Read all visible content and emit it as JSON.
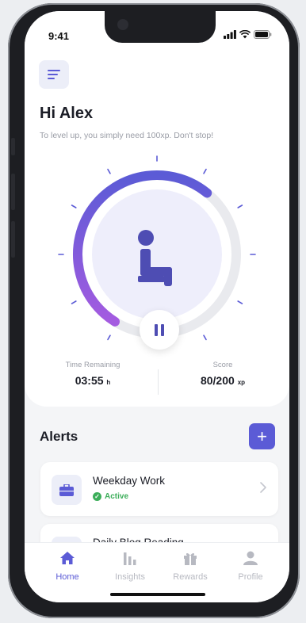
{
  "status_bar": {
    "time": "9:41"
  },
  "header": {
    "greeting": "Hi Alex",
    "subtitle": "To level up, you simply need 100xp. Don't stop!"
  },
  "timer": {
    "progress": 0.52,
    "accent": "#5b5bd6",
    "track": "#e9eaee",
    "stats": {
      "time_label": "Time Remaining",
      "time_value": "03:55",
      "time_unit": "h",
      "score_label": "Score",
      "score_value": "80/200",
      "score_unit": "xp"
    }
  },
  "alerts": {
    "title": "Alerts",
    "add_label": "+",
    "items": [
      {
        "name": "Weekday Work",
        "status": "Active",
        "icon": "briefcase-icon"
      },
      {
        "name": "Daily Blog Reading",
        "status": "",
        "icon": "book-icon"
      }
    ]
  },
  "tabs": [
    {
      "label": "Home",
      "icon": "home-icon",
      "active": true
    },
    {
      "label": "Insights",
      "icon": "bar-chart-icon",
      "active": false
    },
    {
      "label": "Rewards",
      "icon": "gift-icon",
      "active": false
    },
    {
      "label": "Profile",
      "icon": "user-icon",
      "active": false
    }
  ],
  "colors": {
    "accent": "#5b5bd6",
    "success": "#3cae5a",
    "inactive": "#b7b9c1"
  }
}
